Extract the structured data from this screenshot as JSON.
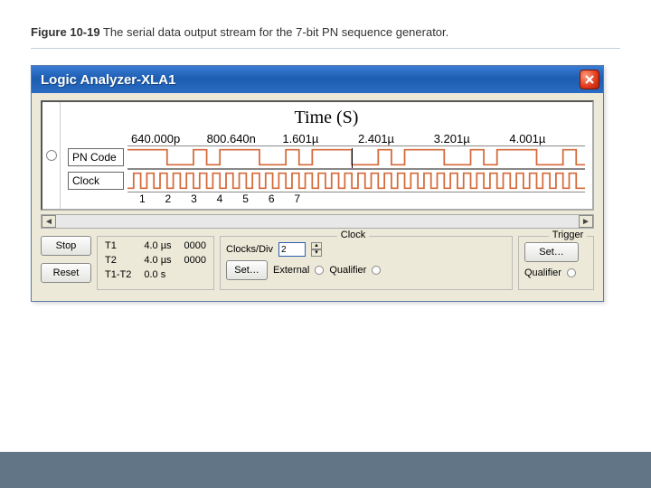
{
  "figure": {
    "num": "Figure 10-19",
    "caption": "The serial data output stream for the 7-bit PN sequence generator."
  },
  "window": {
    "title": "Logic Analyzer-XLA1"
  },
  "plot": {
    "title": "Time (S)",
    "ticks": [
      "640.000p",
      "800.640n",
      "1.601µ",
      "2.401µ",
      "3.201µ",
      "4.001µ"
    ],
    "rows": {
      "pn": "PN Code",
      "clock": "Clock"
    },
    "bitnums": [
      "1",
      "2",
      "3",
      "4",
      "5",
      "6",
      "7"
    ]
  },
  "buttons": {
    "stop": "Stop",
    "reset": "Reset",
    "set": "Set…"
  },
  "tpanel": {
    "t1_label": "T1",
    "t2_label": "T2",
    "dt_label": "T1-T2",
    "t1_val": "4.0 µs",
    "t2_val": "4.0 µs",
    "dt_val": "0.0 s",
    "t1_hex": "0000",
    "t2_hex": "0000"
  },
  "clock": {
    "legend": "Clock",
    "cpd_label": "Clocks/Div",
    "cpd_value": "2",
    "ext": "External",
    "qual": "Qualifier"
  },
  "trigger": {
    "legend": "Trigger",
    "qual": "Qualifier"
  },
  "chart_data": {
    "type": "digital-timing",
    "title": "Time (S)",
    "x_ticks": [
      "640.000p",
      "800.640n",
      "1.601µ",
      "2.401µ",
      "3.201µ",
      "4.001µ"
    ],
    "clock_edges_indexed": [
      1,
      2,
      3,
      4,
      5,
      6,
      7
    ],
    "series": [
      {
        "name": "PN Code",
        "pattern_bits": [
          1,
          1,
          1,
          0,
          0,
          1,
          0,
          1,
          1,
          1,
          0,
          0,
          1,
          0,
          1,
          1,
          1,
          0,
          0,
          1,
          0,
          1,
          1,
          1,
          0,
          0,
          1,
          0,
          1,
          1,
          1,
          0,
          0,
          1,
          0
        ],
        "period_bits": 7
      },
      {
        "name": "Clock",
        "type": "square",
        "duty": 0.5,
        "cycles_visible": 35
      }
    ]
  }
}
